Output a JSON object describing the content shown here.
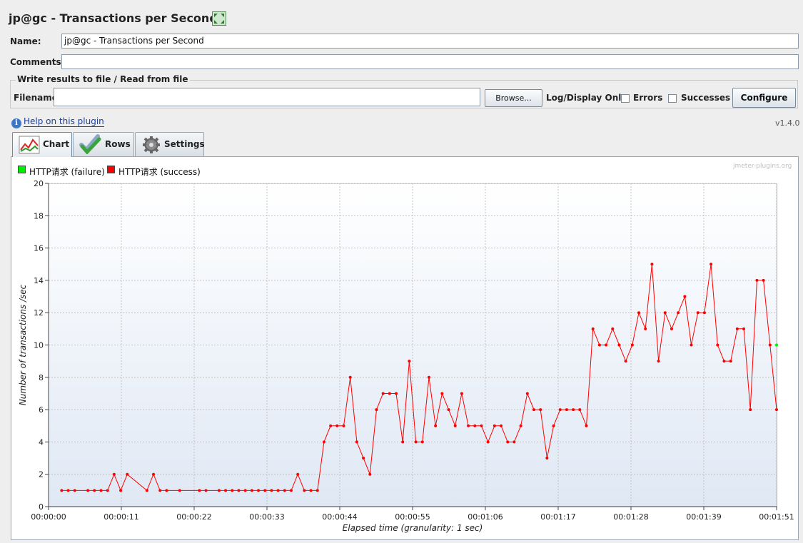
{
  "window": {
    "title": "jp@gc - Transactions per Second"
  },
  "form": {
    "name_label": "Name:",
    "name_value": "jp@gc - Transactions per Second",
    "comments_label": "Comments:",
    "comments_value": ""
  },
  "file_group": {
    "title": "Write results to file / Read from file",
    "filename_label": "Filename",
    "filename_value": "",
    "browse_label": "Browse...",
    "log_display_label": "Log/Display Only:",
    "errors_label": "Errors",
    "errors_checked": false,
    "successes_label": "Successes",
    "successes_checked": false,
    "configure_label": "Configure"
  },
  "help": {
    "link_text": "Help on this plugin",
    "version": "v1.4.0"
  },
  "tabs": [
    {
      "label": "Chart",
      "icon": "chart-icon",
      "active": true
    },
    {
      "label": "Rows",
      "icon": "checkmark-icon",
      "active": false
    },
    {
      "label": "Settings",
      "icon": "gear-icon",
      "active": false
    }
  ],
  "watermark": "jmeter-plugins.org",
  "legend": [
    {
      "label": "HTTP请求 (failure)",
      "color": "#00ee00"
    },
    {
      "label": "HTTP请求 (success)",
      "color": "#ff0000"
    }
  ],
  "chart_data": {
    "type": "line",
    "xlabel": "Elapsed time (granularity: 1 sec)",
    "ylabel": "Number of transactions /sec",
    "ylim": [
      0,
      20
    ],
    "xlim": [
      0,
      111
    ],
    "x_tick_labels": [
      "00:00:00",
      "00:00:11",
      "00:00:22",
      "00:00:33",
      "00:00:44",
      "00:00:55",
      "00:01:06",
      "00:01:17",
      "00:01:28",
      "00:01:39",
      "00:01:51"
    ],
    "y_ticks": [
      0,
      2,
      4,
      6,
      8,
      10,
      12,
      14,
      16,
      18,
      20
    ],
    "grid": true,
    "legend_position": "top-left",
    "series": [
      {
        "name": "HTTP请求 (success)",
        "color": "#ff0000",
        "x": [
          2,
          3,
          4,
          6,
          7,
          8,
          9,
          10,
          11,
          12,
          15,
          16,
          17,
          18,
          20,
          23,
          24,
          26,
          27,
          28,
          29,
          30,
          31,
          32,
          33,
          34,
          35,
          36,
          37,
          38,
          39,
          40,
          41,
          42,
          43,
          44,
          45,
          46,
          47,
          48,
          49,
          50,
          51,
          52,
          53,
          54,
          55,
          56,
          57,
          58,
          59,
          60,
          61,
          62,
          63,
          64,
          65,
          66,
          67,
          68,
          69,
          70,
          71,
          72,
          73,
          74,
          75,
          76,
          77,
          78,
          79,
          80,
          81,
          82,
          83,
          84,
          85,
          86,
          87,
          88,
          89,
          90,
          91,
          92,
          93,
          94,
          95,
          96,
          97,
          98,
          99,
          100,
          101,
          102,
          103,
          104,
          105,
          106,
          107,
          108,
          109,
          110,
          111
        ],
        "y": [
          1,
          1,
          1,
          1,
          1,
          1,
          1,
          2,
          1,
          2,
          1,
          2,
          1,
          1,
          1,
          1,
          1,
          1,
          1,
          1,
          1,
          1,
          1,
          1,
          1,
          1,
          1,
          1,
          1,
          2,
          1,
          1,
          1,
          4,
          5,
          5,
          5,
          8,
          4,
          3,
          2,
          6,
          7,
          7,
          7,
          4,
          9,
          4,
          4,
          8,
          5,
          7,
          6,
          5,
          7,
          5,
          5,
          5,
          4,
          5,
          5,
          4,
          4,
          5,
          7,
          6,
          6,
          3,
          5,
          6,
          6,
          6,
          6,
          5,
          11,
          10,
          10,
          11,
          10,
          9,
          10,
          12,
          11,
          15,
          9,
          12,
          11,
          12,
          13,
          10,
          12,
          12,
          15,
          10,
          9,
          9,
          11,
          11,
          6,
          14,
          14,
          10,
          6
        ]
      },
      {
        "name": "HTTP请求 (failure)",
        "color": "#00ee00",
        "x": [
          111
        ],
        "y": [
          10
        ]
      }
    ]
  }
}
